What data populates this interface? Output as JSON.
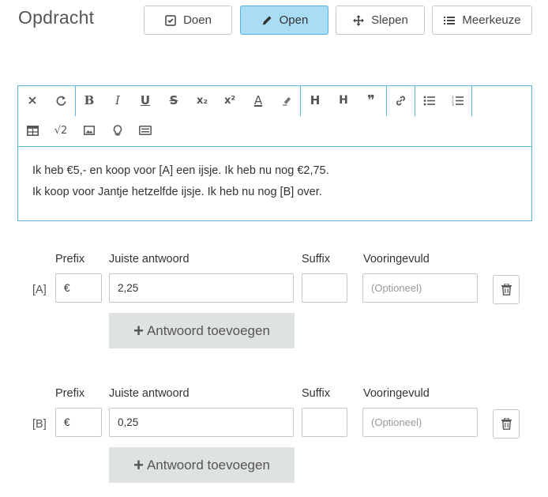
{
  "header": {
    "title": "Opdracht",
    "modes": [
      {
        "label": "Doen",
        "icon": "checkbox-icon"
      },
      {
        "label": "Open",
        "icon": "pencil-icon",
        "active": true
      },
      {
        "label": "Slepen",
        "icon": "move-icon"
      },
      {
        "label": "Meerkeuze",
        "icon": "list-icon"
      }
    ]
  },
  "editor": {
    "toolbar_row1": [
      "clear-format-icon",
      "redo-icon",
      "bold-icon",
      "italic-icon",
      "underline-icon",
      "strikethrough-icon",
      "subscript-icon",
      "superscript-icon",
      "font-color-icon",
      "highlight-icon",
      "heading-icon",
      "heading-2-icon",
      "quote-icon",
      "link-icon",
      "bullet-list-icon",
      "numbered-list-icon"
    ],
    "toolbar_row2": [
      "table-icon",
      "sqrt-icon",
      "image-icon",
      "lightbulb-icon",
      "gap-icon"
    ],
    "glyphs": {
      "bold": "B",
      "italic": "I",
      "underline": "U",
      "strike": "S",
      "sub": "x₂",
      "sup": "x²",
      "color": "A",
      "h1": "H",
      "h2": "H",
      "quote": "❞",
      "sqrt": "√2"
    },
    "lines": [
      "Ik heb €5,- en koop voor [A] een ijsje. Ik heb nu nog €2,75.",
      "Ik koop voor Jantje hetzelfde ijsje. Ik heb nu nog [B] over."
    ]
  },
  "answers": [
    {
      "tag": "[A]",
      "labels": {
        "prefix": "Prefix",
        "answer": "Juiste antwoord",
        "suffix": "Suffix",
        "prefilled": "Vooringevuld"
      },
      "prefix": "€",
      "answer": "2,25",
      "suffix": "",
      "prefilled_placeholder": "(Optioneel)",
      "add_label": "Antwoord toevoegen"
    },
    {
      "tag": "[B]",
      "labels": {
        "prefix": "Prefix",
        "answer": "Juiste antwoord",
        "suffix": "Suffix",
        "prefilled": "Vooringevuld"
      },
      "prefix": "€",
      "answer": "0,25",
      "suffix": "",
      "prefilled_placeholder": "(Optioneel)",
      "add_label": "Antwoord toevoegen"
    }
  ]
}
